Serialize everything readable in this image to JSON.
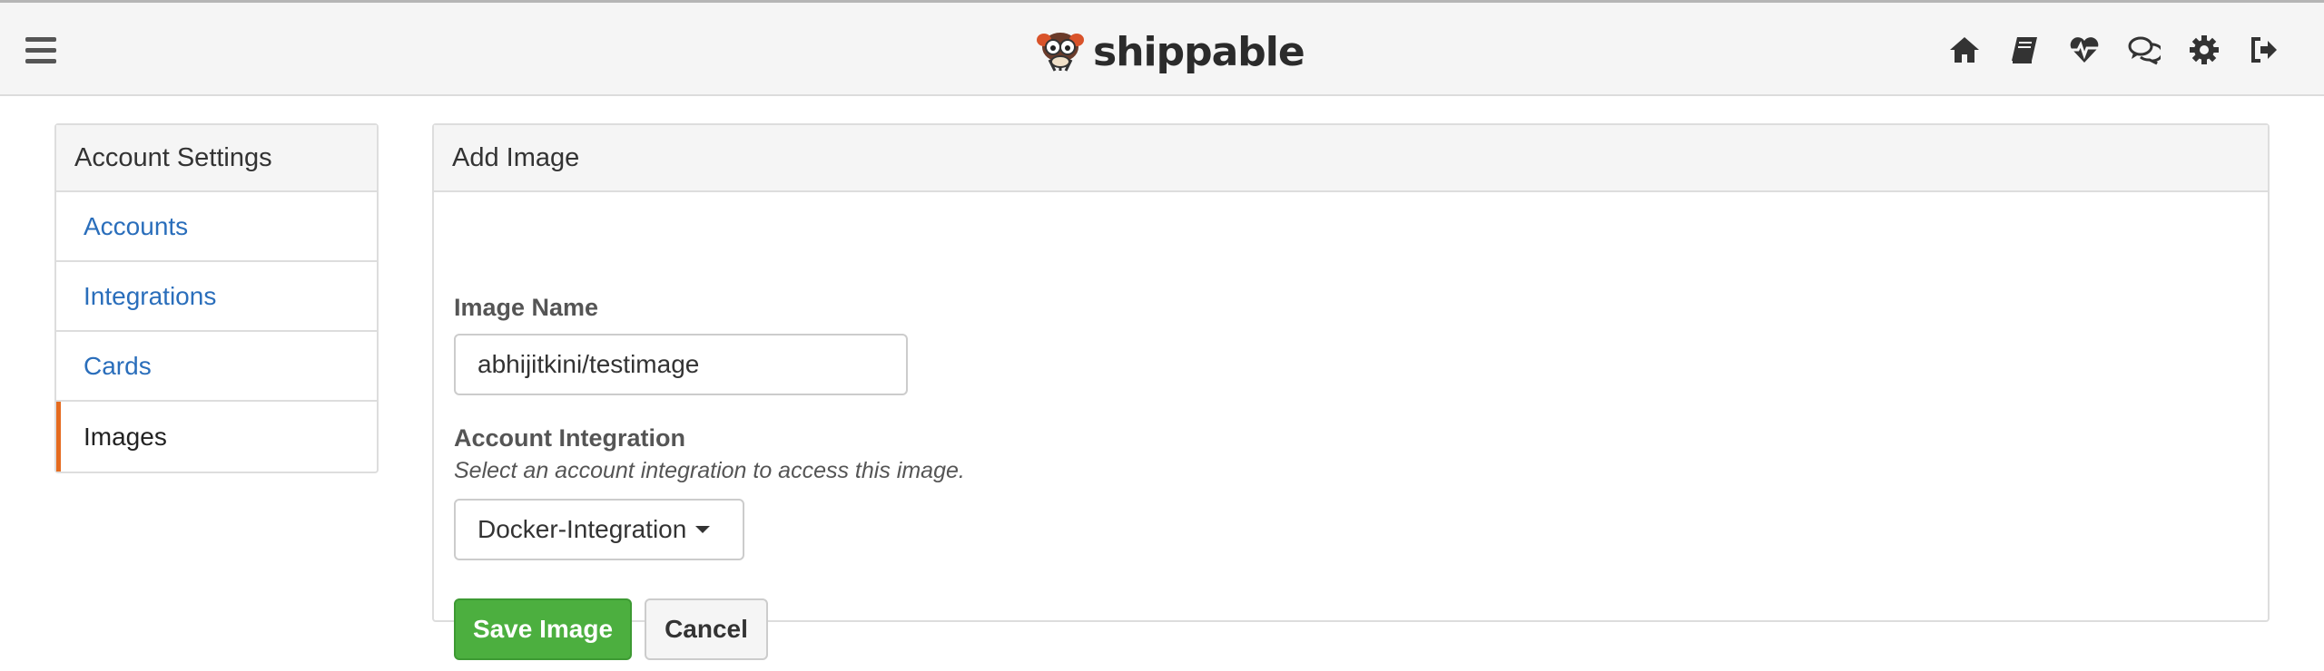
{
  "header": {
    "brand": "shippable",
    "icons": [
      "menu-icon",
      "home-icon",
      "book-icon",
      "heartbeat-icon",
      "comments-icon",
      "gear-icon",
      "sign-out-icon"
    ]
  },
  "sidebar": {
    "title": "Account Settings",
    "items": [
      {
        "label": "Accounts"
      },
      {
        "label": "Integrations"
      },
      {
        "label": "Cards"
      },
      {
        "label": "Images",
        "active": true
      }
    ]
  },
  "main": {
    "title": "Add Image",
    "image_name_label": "Image Name",
    "image_name_value": "abhijitkini/testimage",
    "account_integration_label": "Account Integration",
    "account_integration_help": "Select an account integration to access this image.",
    "account_integration_selected": "Docker-Integration",
    "save_label": "Save Image",
    "cancel_label": "Cancel"
  },
  "colors": {
    "accent": "#e56b1f",
    "link": "#2a6ebb",
    "save_button": "#4caf3f"
  }
}
